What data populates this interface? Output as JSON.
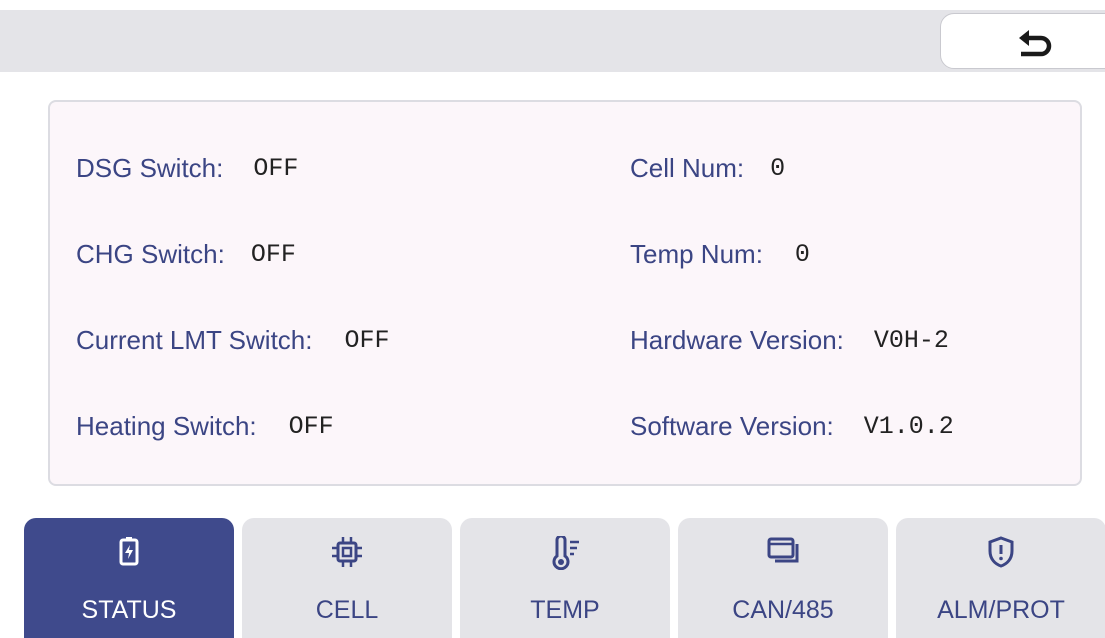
{
  "colors": {
    "accent": "#3f4a8c",
    "label_text": "#3b4584",
    "bar": "#e4e4e8"
  },
  "header": {
    "back_icon": "undo-arrow-icon"
  },
  "status": {
    "left": [
      {
        "label": "DSG Switch:",
        "value": "OFF"
      },
      {
        "label": "CHG Switch:",
        "value": "OFF"
      },
      {
        "label": "Current LMT Switch:",
        "value": "OFF"
      },
      {
        "label": "Heating Switch:",
        "value": "OFF"
      }
    ],
    "right": [
      {
        "label": "Cell Num:",
        "value": "0"
      },
      {
        "label": "Temp Num:",
        "value": "0"
      },
      {
        "label": "Hardware Version:",
        "value": "V0H-2"
      },
      {
        "label": "Software Version:",
        "value": "V1.0.2"
      }
    ]
  },
  "tabs": [
    {
      "label": "STATUS",
      "icon": "battery-charging-icon",
      "active": true
    },
    {
      "label": "CELL",
      "icon": "chip-icon",
      "active": false
    },
    {
      "label": "TEMP",
      "icon": "thermometer-icon",
      "active": false
    },
    {
      "label": "CAN/485",
      "icon": "windows-icon",
      "active": false
    },
    {
      "label": "ALM/PROT",
      "icon": "alert-shield-icon",
      "active": false
    }
  ]
}
